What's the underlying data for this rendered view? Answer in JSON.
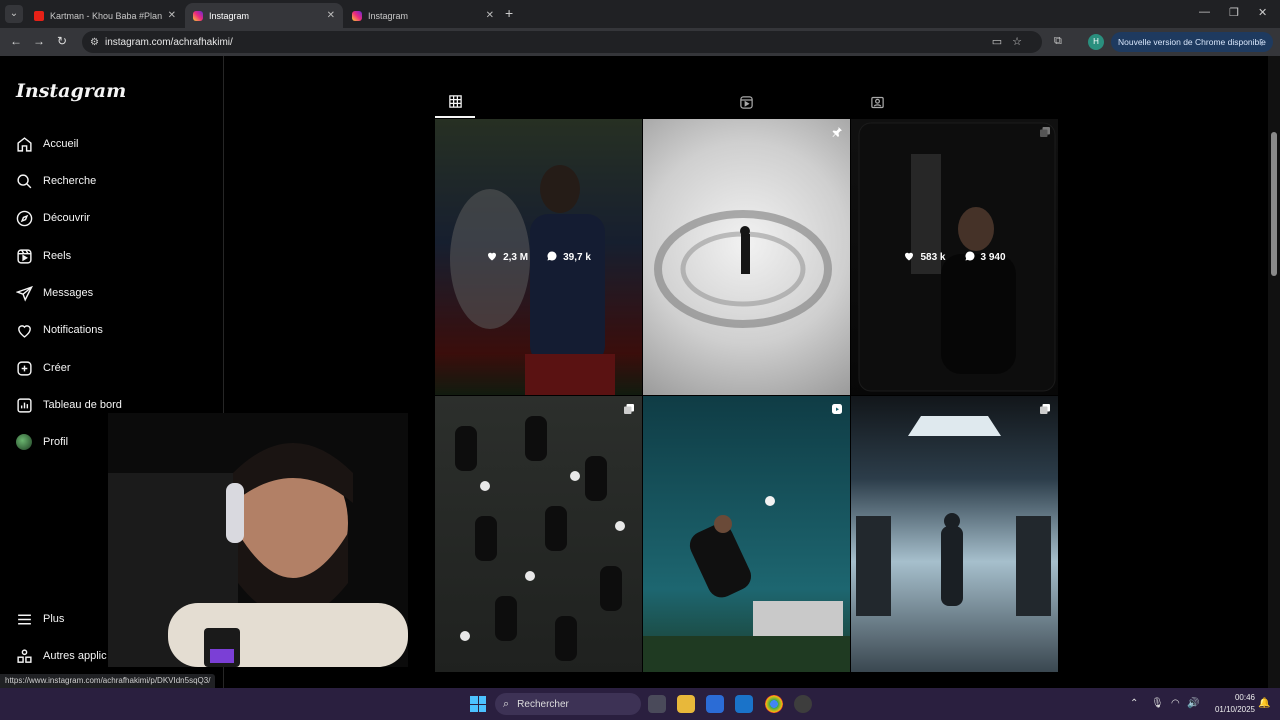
{
  "browser": {
    "tabs": [
      {
        "title": "Kartman - Khou Baba #Planète",
        "favicon": "youtube-icon",
        "active": false
      },
      {
        "title": "Instagram",
        "favicon": "instagram-icon",
        "active": true
      },
      {
        "title": "Instagram",
        "favicon": "instagram-icon",
        "active": false
      }
    ],
    "url": "instagram.com/achrafhakimi/",
    "profile_initial": "H",
    "update_label": "Nouvelle version de Chrome disponible",
    "status_url": "https://www.instagram.com/achrafhakimi/p/DKVIdn5sqQ3/"
  },
  "instagram": {
    "logo": "Instagram",
    "nav": [
      {
        "label": "Accueil",
        "icon": "home-icon"
      },
      {
        "label": "Recherche",
        "icon": "search-icon"
      },
      {
        "label": "Découvrir",
        "icon": "compass-icon"
      },
      {
        "label": "Reels",
        "icon": "reels-icon"
      },
      {
        "label": "Messages",
        "icon": "messages-icon"
      },
      {
        "label": "Notifications",
        "icon": "heart-icon"
      },
      {
        "label": "Créer",
        "icon": "create-icon"
      },
      {
        "label": "Tableau de bord",
        "icon": "dashboard-icon"
      },
      {
        "label": "Profil",
        "icon": "profile-avatar"
      }
    ],
    "more_label": "Plus",
    "other_apps_label": "Autres applic",
    "profile_tabs": [
      "grid-icon",
      "reels-icon",
      "tagged-icon"
    ],
    "posts": [
      {
        "likes": "2,3 M",
        "comments": "39,7 k",
        "badge": null,
        "hovered": true
      },
      {
        "likes": "",
        "comments": "",
        "badge": "pin-icon"
      },
      {
        "likes": "583 k",
        "comments": "3 940",
        "badge": "carousel-icon",
        "hovered": true
      },
      {
        "likes": "",
        "comments": "",
        "badge": "carousel-icon"
      },
      {
        "likes": "",
        "comments": "",
        "badge": "reel-icon"
      },
      {
        "likes": "",
        "comments": "",
        "badge": "carousel-icon"
      }
    ]
  },
  "taskbar": {
    "search_label": "Rechercher",
    "time": "00:46",
    "date": "01/10/2025"
  }
}
